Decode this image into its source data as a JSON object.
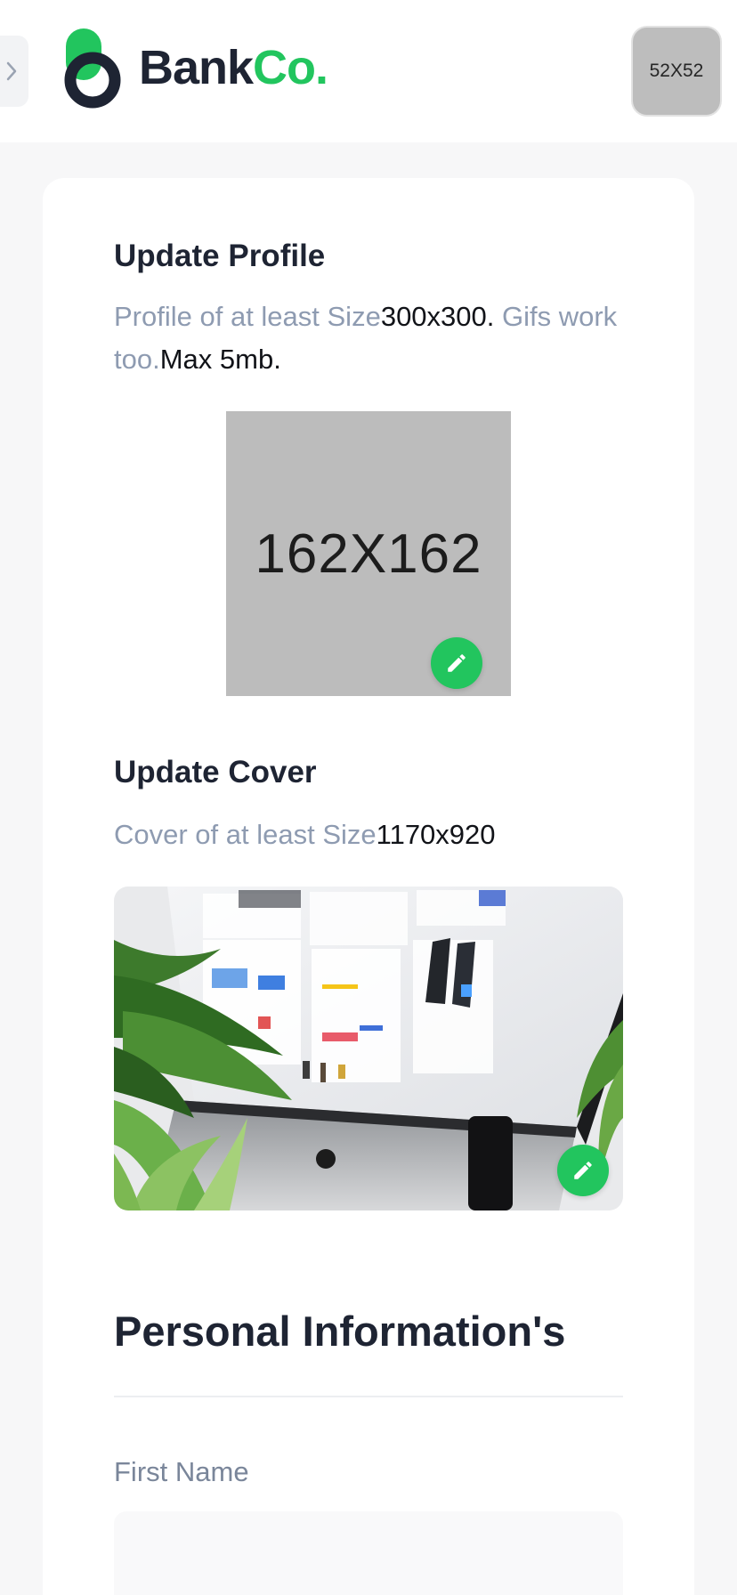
{
  "header": {
    "logo": {
      "word1": "Bank",
      "word2": "Co."
    },
    "avatar_placeholder": "52X52"
  },
  "profile": {
    "title": "Update Profile",
    "desc_part1": "Profile of at least Size",
    "desc_size": "300x300.",
    "desc_part2": " Gifs work too.",
    "desc_max": "Max 5mb.",
    "image_placeholder": "162X162"
  },
  "cover": {
    "title": "Update Cover",
    "desc_part1": "Cover of at least Size",
    "desc_size": "1170x920"
  },
  "personal": {
    "title": "Personal Information's",
    "first_name_label": "First Name",
    "first_name_value": ""
  },
  "colors": {
    "brand_green": "#22c55e",
    "text_dark": "#1e2433",
    "text_muted": "#8e9bb1",
    "page_bg": "#f7f7f8"
  }
}
